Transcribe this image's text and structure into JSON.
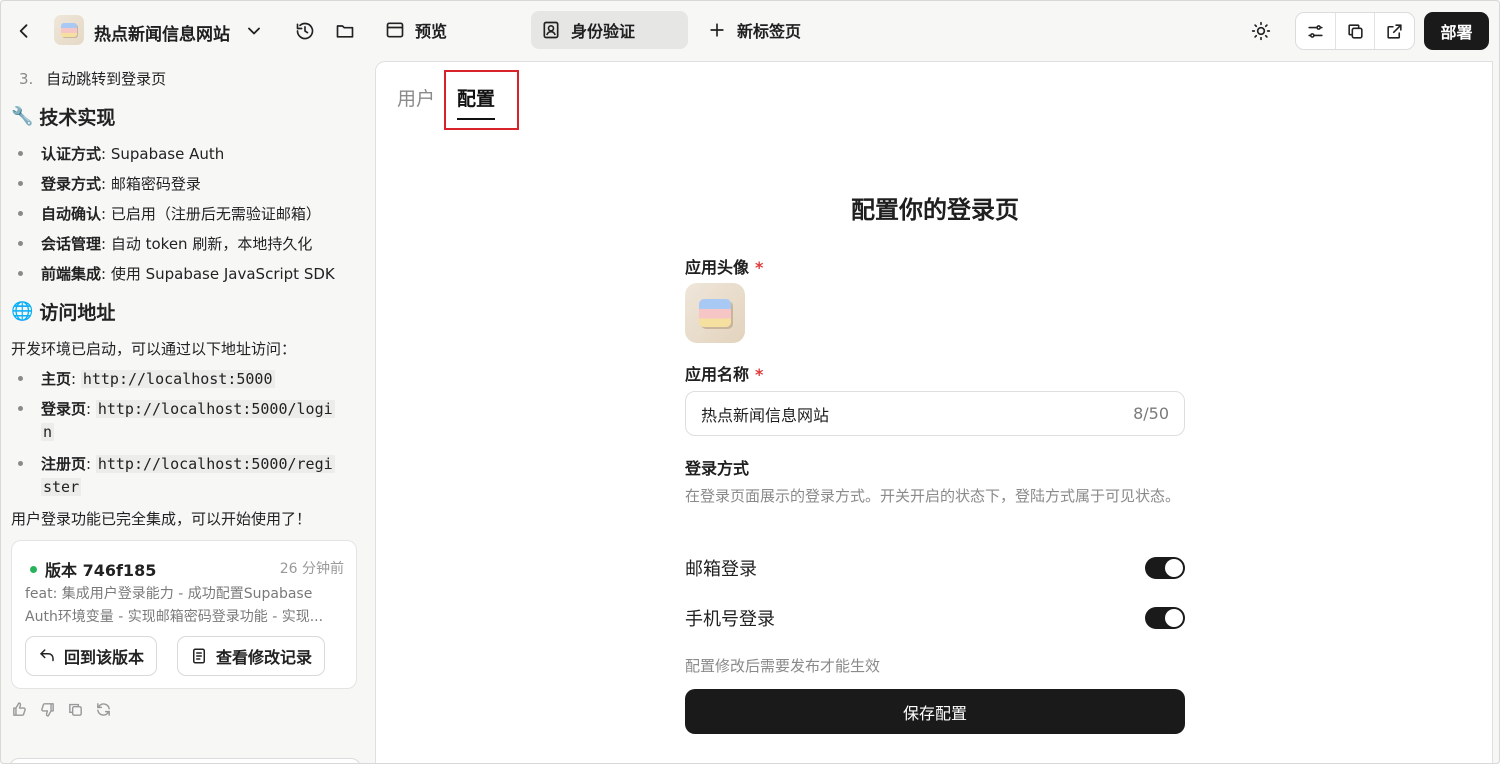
{
  "topbar": {
    "app_title": "热点新闻信息网站",
    "tabs": [
      {
        "label": "预览"
      },
      {
        "label": "身份验证"
      },
      {
        "label": "新标签页"
      }
    ],
    "deploy_label": "部署"
  },
  "chat": {
    "step3": "自动跳转到登录页",
    "tech_heading": "技术实现",
    "tech_items": [
      {
        "key": "认证方式",
        "value": ": Supabase Auth"
      },
      {
        "key": "登录方式",
        "value": ": 邮箱密码登录"
      },
      {
        "key": "自动确认",
        "value": ": 已启用（注册后无需验证邮箱）"
      },
      {
        "key": "会话管理",
        "value": ": 自动 token 刷新，本地持久化"
      },
      {
        "key": "前端集成",
        "value": ": 使用 Supabase JavaScript SDK"
      }
    ],
    "access_heading": "访问地址",
    "access_intro": "开发环境已启动，可以通过以下地址访问：",
    "links": [
      {
        "key": "主页",
        "line1": "http://localhost:5000",
        "line2": ""
      },
      {
        "key": "登录页",
        "line1": "http://localhost:5000/logi",
        "line2": "n"
      },
      {
        "key": "注册页",
        "line1": "http://localhost:5000/regi",
        "line2": "ster"
      }
    ],
    "done_text": "用户登录功能已完全集成，可以开始使用了！",
    "version": {
      "title": "版本 746f185",
      "time": "26 分钟前",
      "desc": "feat: 集成用户登录能力 - 成功配置Supabase Auth环境变量 - 实现邮箱密码登录功能 - 实现...",
      "revert_label": "回到该版本",
      "changes_label": "查看修改记录"
    }
  },
  "config": {
    "tab_user": "用户",
    "tab_config": "配置",
    "title": "配置你的登录页",
    "avatar_label": "应用头像",
    "name_label": "应用名称",
    "required_mark": "*",
    "name_value": "热点新闻信息网站",
    "name_counter": "8/50",
    "login_method_label": "登录方式",
    "login_method_hint": "在登录页面展示的登录方式。开关开启的状态下，登陆方式属于可见状态。",
    "methods": [
      {
        "label": "邮箱登录",
        "enabled": true
      },
      {
        "label": "手机号登录",
        "enabled": true
      }
    ],
    "note": "配置修改后需要发布才能生效",
    "save_label": "保存配置"
  },
  "colors": {
    "primary": "#1a1a1a",
    "required": "#e03a3a",
    "highlight": "#d9232b",
    "status_dot": "#27b35a"
  }
}
